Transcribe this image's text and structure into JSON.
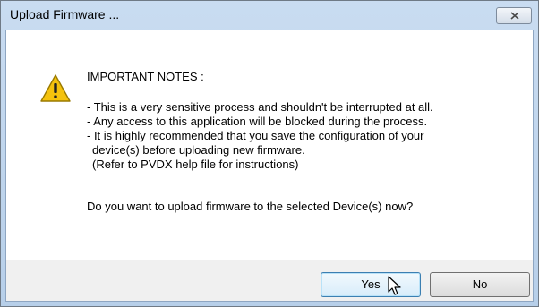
{
  "window": {
    "title": "Upload Firmware ..."
  },
  "dialog": {
    "icon": "warning-triangle-icon",
    "notes_title": "IMPORTANT NOTES :",
    "notes": [
      "- This is a very sensitive process and shouldn't be interrupted at all.",
      "- Any access to this application will be blocked during the process.",
      "- It is highly recommended that you save the configuration of your",
      "  device(s) before uploading new firmware.",
      "  (Refer to PVDX help file for instructions)"
    ],
    "question": "Do you want to upload firmware to the selected Device(s) now?"
  },
  "buttons": {
    "yes_label": "Yes",
    "no_label": "No"
  },
  "colors": {
    "title_bar": "#c9dcf1",
    "footer": "#f0f0f0",
    "warning_fill": "#f4c20d"
  }
}
